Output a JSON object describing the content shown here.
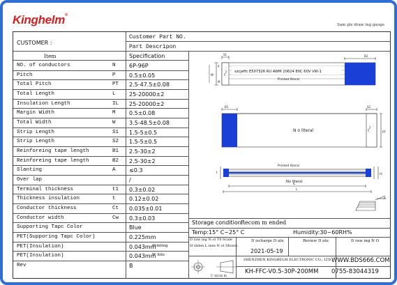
{
  "brand": {
    "name": "Kinghelm",
    "mark": "®",
    "color": "#d81e1e"
  },
  "sample_note": "Sam ple draw ing gauge",
  "header": {
    "customer_label": "CUSTOMER :",
    "customer_part_label": "Customer Part NO.",
    "part_desc_label": "Part Descripon"
  },
  "table": {
    "item_header": "Item",
    "spec_header": "Specification",
    "rows": [
      {
        "item": "NO. of conductors",
        "sym": "N",
        "value": "6P-96P"
      },
      {
        "item": "Pitch",
        "sym": "P",
        "value": "0.5±0.05"
      },
      {
        "item": "Total Pitch",
        "sym": "PT",
        "value": "2.5-47.5±0.08"
      },
      {
        "item": "Total Length",
        "sym": "L",
        "value": "25-20000±2"
      },
      {
        "item": "Insulation Length",
        "sym": "IL",
        "value": "25-20000±2"
      },
      {
        "item": "Margin Width",
        "sym": "M",
        "value": "0.5±0.08"
      },
      {
        "item": "Total Width",
        "sym": "W",
        "value": "3.5-48.5±0.08"
      },
      {
        "item": "Strip Length",
        "sym": "S1",
        "value": "1.5-5±0.5"
      },
      {
        "item": "Strip Length",
        "sym": "S2",
        "value": "1.5-5±0.5"
      },
      {
        "item": "Reinforeing tape length",
        "sym": "B1",
        "value": "2.5-30±2"
      },
      {
        "item": "Reinforeing tape length",
        "sym": "B2",
        "value": "2.5-30±2"
      },
      {
        "item": "Slanting",
        "sym": "A",
        "value": "≤0.3"
      },
      {
        "item": "Over lap",
        "sym": "",
        "value": "/"
      },
      {
        "item": "Terminal thickness",
        "sym": "t1",
        "value": "0.3±0.02"
      },
      {
        "item": "Thickness insulation",
        "sym": "t",
        "value": "0.12±0.02"
      },
      {
        "item": "Conductor thickness",
        "sym": "Ct",
        "value": "0.035±0.01"
      },
      {
        "item": "Conductor width",
        "sym": "Cw",
        "value": "0.3±0.03"
      },
      {
        "item": "Supporting Tapc Color",
        "sym": "",
        "value": "Blue"
      },
      {
        "item": "PET(Supporing Tapc Color)",
        "sym": "",
        "value": "0.225mm"
      },
      {
        "item": "PET(Insulation)",
        "sym": "",
        "value": "0.043mm",
        "note": "Printing"
      },
      {
        "item": "PET(Insulation)",
        "sym": "",
        "value": "0.043mm",
        "note": "W hite"
      },
      {
        "item": "Rev",
        "sym": "",
        "value": "B"
      }
    ]
  },
  "drawing": {
    "printed_text": "szcjeffc E507326 RU AWM 20624 80C 60V VW-1",
    "printed_literal": "Printed lIteral",
    "no_literal": "N o lIteral",
    "side_no_literal": "No lIteral",
    "dims": {
      "S1": "S1",
      "B2": "B2",
      "B1": "B1",
      "S2": "S2",
      "PT": "PT",
      "W": "W",
      "P": "P",
      "M": "M",
      "A": "A",
      "IL": "IL",
      "L": "L",
      "t": "t",
      "t1": "t1",
      "Ct": "Ct",
      "Cw": "Cw"
    },
    "accent": "#1a3fd6"
  },
  "footer": {
    "storage_label": "Storage condition",
    "storage_value": "Recom m ended",
    "temp": "Temp:15° C~25° C",
    "humidity": "Humidity:30~60RH%",
    "drawing_note_1": "D raw ing N ot T0 Scale",
    "drawing_note_2": "H idden L ines N ot Shown",
    "discharge_date_label": "D ischarge D ate",
    "discharge_date": "2021-05-19",
    "review_date_label": "Review D ate",
    "drawing_no_label": "D raw ing N O",
    "company": "SHENZHEN KINGHELM ELECTRONIC CO., LTD.",
    "part_number": "KH-FFC-V0.5-30P-200MM",
    "website": "WWW.BDS666.COM",
    "phone": "0755-83044319",
    "projection_label": "U nit:m m"
  }
}
